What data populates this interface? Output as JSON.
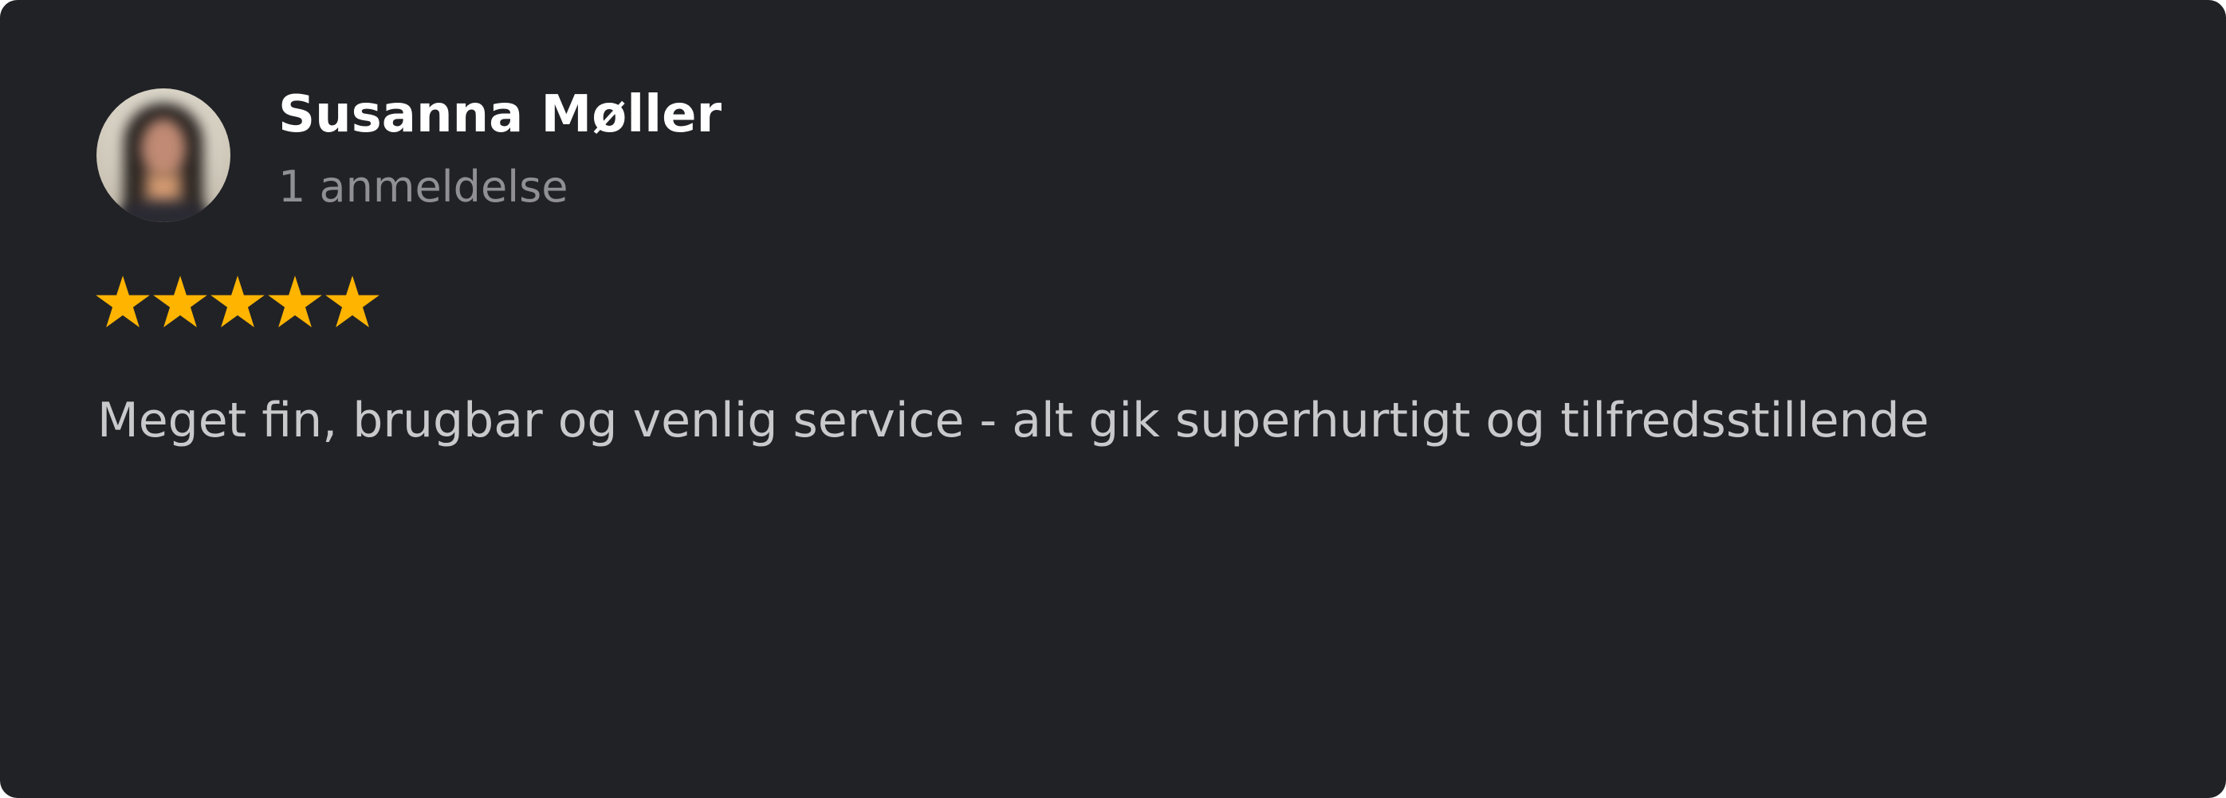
{
  "review": {
    "author_name": "Susanna Møller",
    "review_count": "1 anmeldelse",
    "rating": 5,
    "max_rating": 5,
    "text": "Meget fin, brugbar og venlig service - alt gik superhurtigt og tilfredsstillende"
  },
  "colors": {
    "card_background": "#212226",
    "name": "#ffffff",
    "meta": "#909094",
    "body_text": "#c9c9cc",
    "star": "#FFB400"
  },
  "icons": {
    "rating_star": "star-icon"
  }
}
